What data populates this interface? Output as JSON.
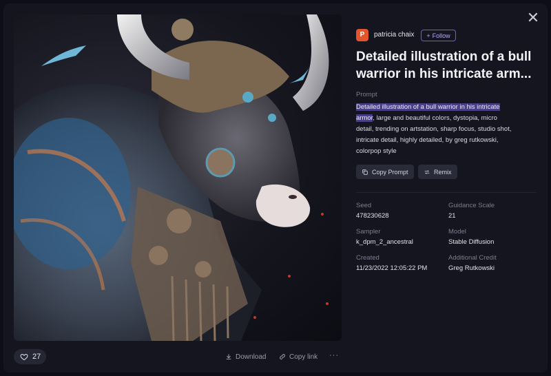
{
  "author": {
    "initial": "P",
    "name": "patricia chaix",
    "follow_label": "Follow"
  },
  "title": "Detailed illustration of a bull warrior in his intricate arm...",
  "prompt": {
    "label": "Prompt",
    "highlighted": "Detailed illustration of a bull warrior in his intricate armor",
    "rest": ", large and beautiful colors, dystopia, micro detail, trending on artstation, sharp focus, studio shot, intricate detail, highly detailed, by greg rutkowski, colorpop style"
  },
  "buttons": {
    "copy_prompt": "Copy Prompt",
    "remix": "Remix"
  },
  "meta": {
    "seed_label": "Seed",
    "seed": "478230628",
    "guidance_label": "Guidance Scale",
    "guidance": "21",
    "sampler_label": "Sampler",
    "sampler": "k_dpm_2_ancestral",
    "model_label": "Model",
    "model": "Stable Diffusion",
    "created_label": "Created",
    "created": "11/23/2022 12:05:22 PM",
    "credit_label": "Additional Credit",
    "credit": "Greg Rutkowski"
  },
  "footer": {
    "likes": "27",
    "download": "Download",
    "copy_link": "Copy link",
    "more": "···"
  },
  "icons": {
    "close": "close-icon",
    "heart": "heart-icon",
    "download": "download-icon",
    "link": "link-icon",
    "copy": "copy-icon",
    "remix": "remix-icon",
    "plus": "plus-icon"
  },
  "colors": {
    "accent": "#6d5ce8",
    "avatar": "#e2542b",
    "highlight": "#4a3f86",
    "background": "#14151f"
  }
}
